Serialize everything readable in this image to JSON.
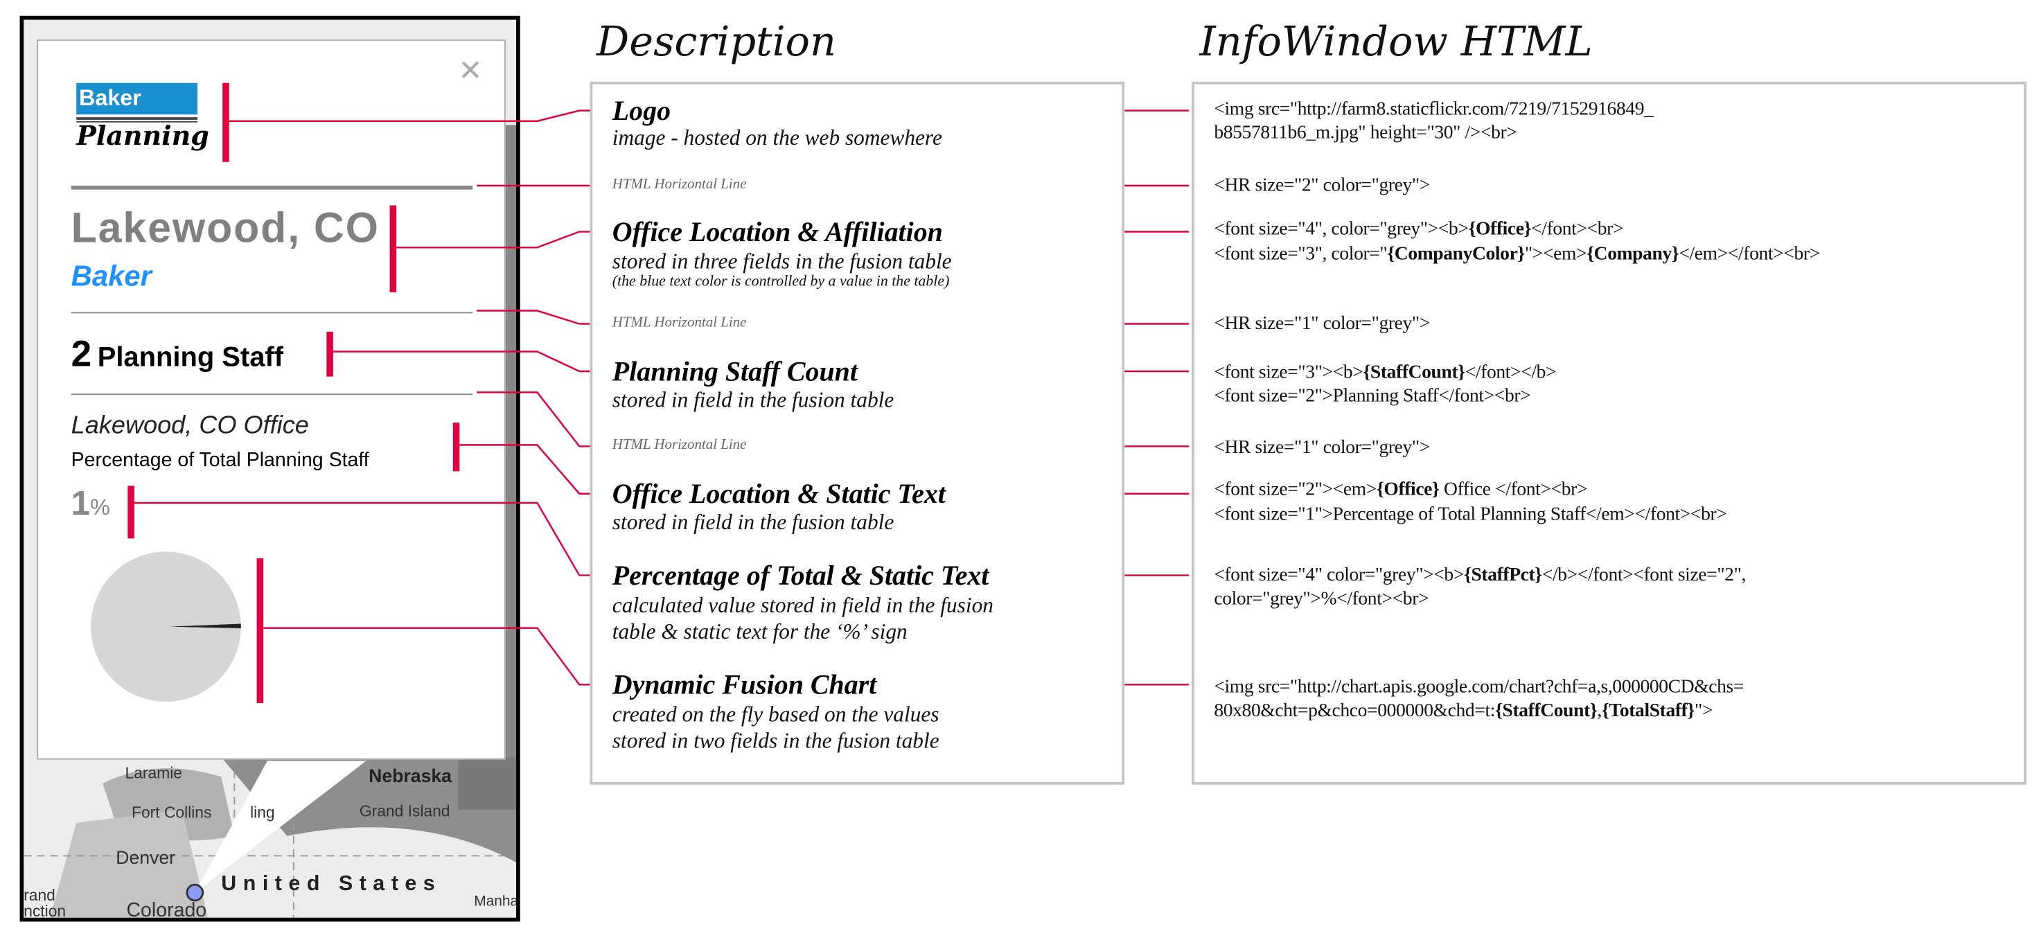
{
  "columns": {
    "description_title": "Description",
    "html_title": "InfoWindow HTML"
  },
  "map": {
    "labels": [
      "Laramie",
      "Nebraska",
      "Fort Collins",
      "ling",
      "Grand Island",
      "Denver",
      "United States",
      "rand",
      "nction",
      "Colorado",
      "Manha"
    ],
    "marker_color": "#8a9cf5"
  },
  "info_window": {
    "close_icon": "close-icon",
    "logo": {
      "top": "Baker",
      "bottom": "Planning",
      "brand_color": "#1a8fd0"
    },
    "office": "Lakewood, CO",
    "company": "Baker",
    "company_color": "#1e90ff",
    "staff_count": "2",
    "staff_label": "Planning Staff",
    "office_line": "Lakewood, CO Office",
    "pct_label": "Percentage of Total Planning Staff",
    "pct_value": "1",
    "pct_sign": "%"
  },
  "chart_data": {
    "type": "pie",
    "values": [
      1,
      99
    ],
    "colors": [
      "#222222",
      "#d6d6d6"
    ]
  },
  "description": {
    "items": [
      {
        "heading": "Logo",
        "lines": [
          "image - hosted on the web somewhere"
        ]
      },
      {
        "hr": "HTML Horizontal Line"
      },
      {
        "heading": "Office Location & Affiliation",
        "lines": [
          "stored in three fields in the fusion table"
        ],
        "note": "(the blue text color is controlled by a value in the table)"
      },
      {
        "hr": "HTML Horizontal Line"
      },
      {
        "heading": "Planning Staff Count",
        "lines": [
          "stored in field in the fusion table"
        ]
      },
      {
        "hr": "HTML Horizontal Line"
      },
      {
        "heading": "Office Location & Static Text",
        "lines": [
          "stored in field in the fusion table"
        ]
      },
      {
        "heading": "Percentage of Total & Static Text",
        "lines": [
          "calculated value stored in field in the fusion",
          "table & static text for the ‘%’ sign"
        ]
      },
      {
        "heading": "Dynamic Fusion Chart",
        "lines": [
          "created on the fly based on the values",
          "stored in two fields in the fusion table"
        ]
      }
    ]
  },
  "html_code": {
    "logo": [
      "<img src=\"http://farm8.staticflickr.com/7219/7152916849_",
      "b8557811b6_m.jpg\" height=\"30\" /><br>"
    ],
    "hr1": "<HR size=\"2\" color=\"grey\">",
    "office": {
      "a1": "<font size=\"4\", color=\"grey\"><b>",
      "b1": "{Office}",
      "c1": "</font><br>",
      "a2": "<font size=\"3\", color=\"",
      "b2": "{CompanyColor}",
      "c2": "\"><em>",
      "d2": "{Company}",
      "e2": "</em></font><br>"
    },
    "hr2": "<HR size=\"1\" color=\"grey\">",
    "staff": {
      "a1": "<font size=\"3\"><b>",
      "b1": "{StaffCount}",
      "c1": "</font></b>",
      "l2": "<font size=\"2\">Planning Staff</font><br>"
    },
    "hr3": "<HR size=\"1\" color=\"grey\">",
    "officetext": {
      "a1": "<font size=\"2\"><em>",
      "b1": "{Office}",
      "c1": " Office </font><br>",
      "l2": "<font size=\"1\">Percentage of Total Planning Staff</em></font><br>"
    },
    "pct": {
      "a1": "<font size=\"4\" color=\"grey\"><b>",
      "b1": "{StaffPct}",
      "c1": "</b></font><font size=\"2\",",
      "l2": "color=\"grey\">%</font><br>"
    },
    "chart": {
      "l1": "<img src=\"http://chart.apis.google.com/chart?chf=a,s,000000CD&chs=",
      "a2": "80x80&cht=p&chco=000000&chd=t:",
      "b2": "{StaffCount}",
      "c2": ",",
      "d2": "{TotalStaff}",
      "e2": "\">"
    }
  },
  "accent_color": "#e0003f"
}
